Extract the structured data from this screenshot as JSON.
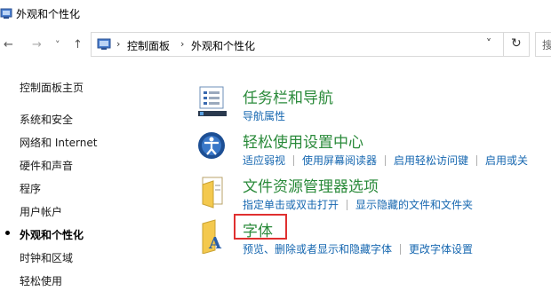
{
  "window": {
    "title": "外观和个性化"
  },
  "nav": {
    "back": "←",
    "forward": "→",
    "recent": "˅",
    "up": "↑",
    "breadcrumb": [
      "控制面板",
      "外观和个性化"
    ],
    "dropdown": "˅",
    "refresh": "↻",
    "search_placeholder": "搜"
  },
  "sidebar": {
    "items": [
      {
        "label": "控制面板主页"
      },
      {
        "label": "系统和安全"
      },
      {
        "label": "网络和 Internet"
      },
      {
        "label": "硬件和声音"
      },
      {
        "label": "程序"
      },
      {
        "label": "用户帐户"
      },
      {
        "label": "外观和个性化"
      },
      {
        "label": "时钟和区域"
      },
      {
        "label": "轻松使用"
      }
    ],
    "active_index": 6
  },
  "categories": [
    {
      "title": "任务栏和导航",
      "links": [
        "导航属性"
      ]
    },
    {
      "title": "轻松使用设置中心",
      "links": [
        "适应弱视",
        "使用屏幕阅读器",
        "启用轻松访问键",
        "启用或关"
      ]
    },
    {
      "title": "文件资源管理器选项",
      "links": [
        "指定单击或双击打开",
        "显示隐藏的文件和文件夹"
      ]
    },
    {
      "title": "字体",
      "links": [
        "预览、删除或者显示和隐藏字体",
        "更改字体设置"
      ]
    }
  ],
  "colors": {
    "heading": "#2a8a3a",
    "link": "#1667b0",
    "highlight": "#e03030"
  }
}
